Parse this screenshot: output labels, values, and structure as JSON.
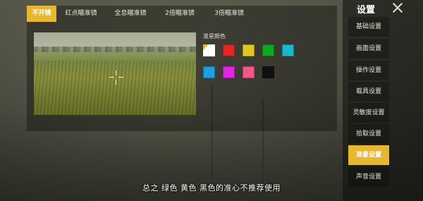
{
  "scope_tabs": [
    {
      "label": "不开镜",
      "active": true
    },
    {
      "label": "红点瞄准镜",
      "active": false
    },
    {
      "label": "全息瞄准镜",
      "active": false
    },
    {
      "label": "2倍瞄准镜",
      "active": false
    },
    {
      "label": "3倍瞄准镜",
      "active": false
    }
  ],
  "crosshair_color": {
    "label": "准星颜色",
    "swatches": [
      {
        "color": "#ffffff",
        "selected": true
      },
      {
        "color": "#e02828"
      },
      {
        "color": "#e0c820"
      },
      {
        "color": "#10a820"
      },
      {
        "color": "#18b8d0"
      },
      {
        "color": "#1ea0e0"
      },
      {
        "color": "#e028e0"
      },
      {
        "color": "#f05888"
      },
      {
        "color": "#101010"
      }
    ]
  },
  "settings_menu": {
    "title": "设置",
    "items": [
      {
        "label": "基础设置"
      },
      {
        "label": "画面设置"
      },
      {
        "label": "操作设置"
      },
      {
        "label": "载具设置"
      },
      {
        "label": "灵敏度设置"
      },
      {
        "label": "拾取设置"
      },
      {
        "label": "准星设置",
        "active": true
      },
      {
        "label": "声音设置"
      }
    ]
  },
  "subtitle": "总之  绿色  黄色  黑色的准心不推荐使用",
  "accent_color": "#e8b730"
}
